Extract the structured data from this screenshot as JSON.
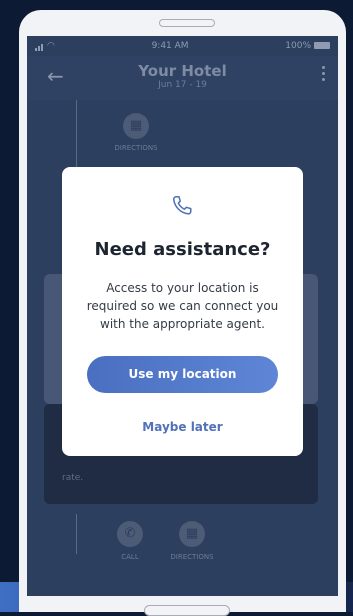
{
  "status_bar": {
    "time": "9:41 AM",
    "battery": "100%"
  },
  "app_bar": {
    "title": "Your Hotel",
    "dates": "Jun 17 - 19"
  },
  "background": {
    "directions_label": "DIRECTIONS",
    "call_label": "CALL",
    "rate_fragment": "rate."
  },
  "modal": {
    "icon": "phone-icon",
    "title": "Need assistance?",
    "body": "Access to your location is required so we can connect you with the appropriate agent.",
    "primary_label": "Use my location",
    "secondary_label": "Maybe later"
  }
}
